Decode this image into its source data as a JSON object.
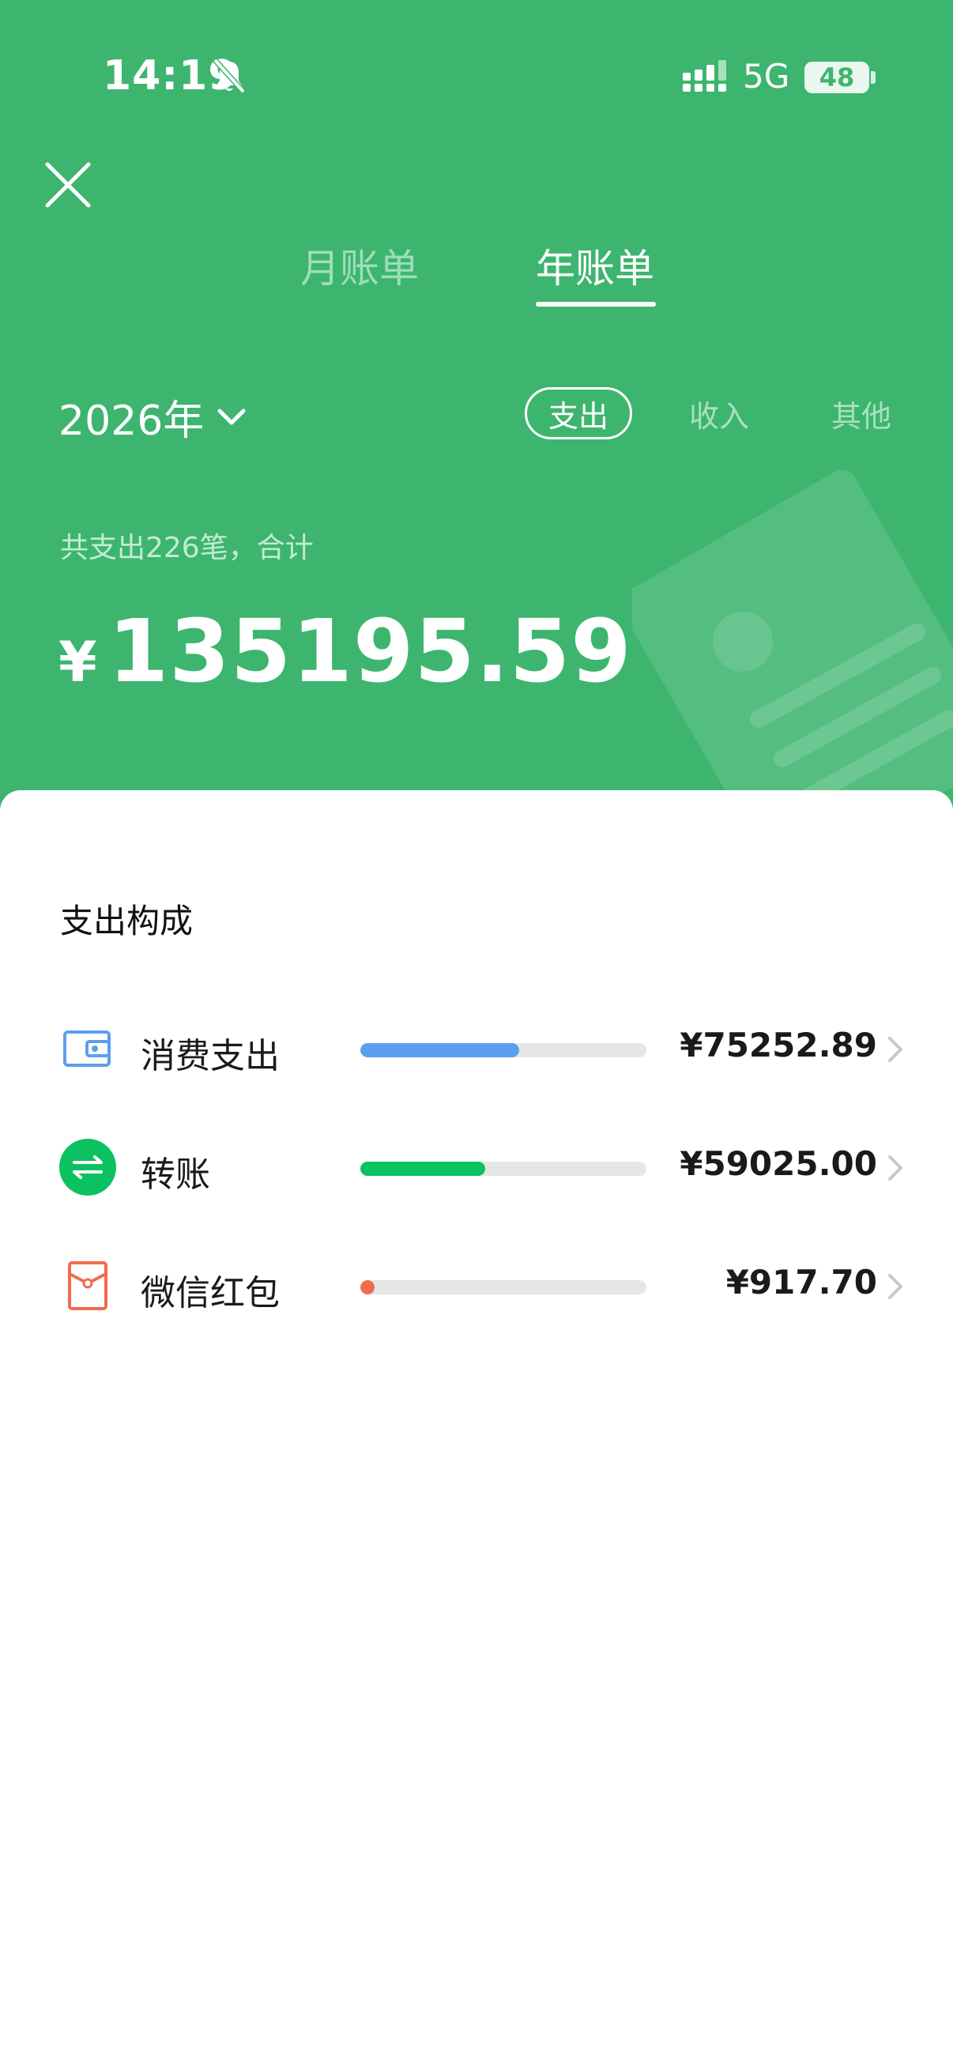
{
  "status_bar": {
    "time": "14:19",
    "network": "5G",
    "battery": "48",
    "icons": [
      "bell-muted-icon",
      "signal-icon"
    ]
  },
  "tabs": [
    {
      "label": "月账单",
      "active": false
    },
    {
      "label": "年账单",
      "active": true
    }
  ],
  "year_selector": {
    "label": "2026年"
  },
  "filters": [
    {
      "label": "支出",
      "active": true
    },
    {
      "label": "收入",
      "active": false
    },
    {
      "label": "其他",
      "active": false
    }
  ],
  "summary": {
    "text": "共支出226笔，合计",
    "currency": "¥",
    "total": "135195.59"
  },
  "breakdown": {
    "title": "支出构成",
    "items": [
      {
        "label": "消费支出",
        "amount": "¥75252.89",
        "share": 0.5566,
        "color": "#5b9ef0",
        "icon": "wallet-icon"
      },
      {
        "label": "转账",
        "amount": "¥59025.00",
        "share": 0.4366,
        "color": "#0cc160",
        "icon": "transfer-icon"
      },
      {
        "label": "微信红包",
        "amount": "¥917.70",
        "share": 0.0068,
        "color": "#f26b4f",
        "icon": "red-packet-icon"
      }
    ]
  },
  "colors": {
    "header_green": "#3db56f",
    "expense_blue": "#5b9ef0",
    "transfer_green": "#0cc160",
    "red_packet": "#f26b4f"
  }
}
